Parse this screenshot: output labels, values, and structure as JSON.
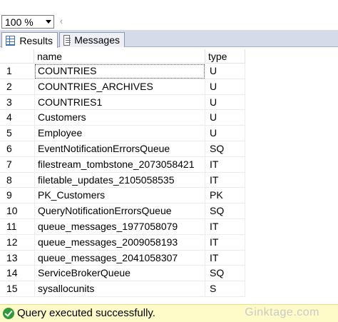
{
  "toolbar": {
    "zoom_value": "100 %",
    "scroll_left_glyph": "‹"
  },
  "tabs": [
    {
      "label": "Results",
      "icon": "grid-icon",
      "active": true
    },
    {
      "label": "Messages",
      "icon": "messages-icon",
      "active": false
    }
  ],
  "grid": {
    "columns": [
      "name",
      "type"
    ],
    "rows": [
      {
        "num": "1",
        "name": "COUNTRIES",
        "type": "U"
      },
      {
        "num": "2",
        "name": "COUNTRIES_ARCHIVES",
        "type": "U"
      },
      {
        "num": "3",
        "name": "COUNTRIES1",
        "type": "U"
      },
      {
        "num": "4",
        "name": "Customers",
        "type": "U"
      },
      {
        "num": "5",
        "name": "Employee",
        "type": "U"
      },
      {
        "num": "6",
        "name": "EventNotificationErrorsQueue",
        "type": "SQ"
      },
      {
        "num": "7",
        "name": "filestream_tombstone_2073058421",
        "type": "IT"
      },
      {
        "num": "8",
        "name": "filetable_updates_2105058535",
        "type": "IT"
      },
      {
        "num": "9",
        "name": "PK_Customers",
        "type": "PK"
      },
      {
        "num": "10",
        "name": "QueryNotificationErrorsQueue",
        "type": "SQ"
      },
      {
        "num": "11",
        "name": "queue_messages_1977058079",
        "type": "IT"
      },
      {
        "num": "12",
        "name": "queue_messages_2009058193",
        "type": "IT"
      },
      {
        "num": "13",
        "name": "queue_messages_2041058307",
        "type": "IT"
      },
      {
        "num": "14",
        "name": "ServiceBrokerQueue",
        "type": "SQ"
      },
      {
        "num": "15",
        "name": "sysallocunits",
        "type": "S"
      }
    ]
  },
  "status": {
    "text": "Query executed successfully.",
    "icon": "success-check-icon",
    "watermark": "Ginktage.com"
  }
}
